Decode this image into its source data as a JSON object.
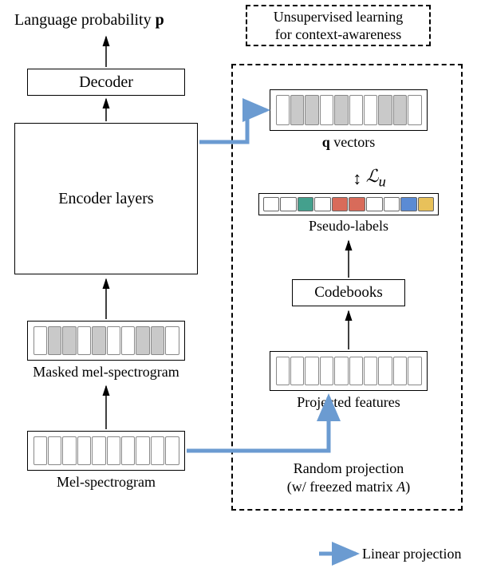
{
  "title_box": "Unsupervised learning\nfor context-awareness",
  "top_label_prefix": "Language probability ",
  "top_label_var": "p",
  "decoder": "Decoder",
  "encoder": "Encoder layers",
  "masked_mel": "Masked mel-spectrogram",
  "mel": "Mel-spectrogram",
  "q_vectors_prefix": "q",
  "q_vectors_suffix": " vectors",
  "pseudo_labels": "Pseudo-labels",
  "codebooks": "Codebooks",
  "projected_features": "Projected features",
  "random_projection": "Random projection",
  "random_projection_sub": "(w/ freezed matrix A)",
  "loss_label": "ℒ",
  "loss_sub": "u",
  "legend": "Linear projection",
  "colors_masked": [
    "#fff",
    "#c9c9c9",
    "#c9c9c9",
    "#fff",
    "#c9c9c9",
    "#fff",
    "#fff",
    "#c9c9c9",
    "#c9c9c9",
    "#fff"
  ],
  "colors_q": [
    "#fff",
    "#c9c9c9",
    "#c9c9c9",
    "#fff",
    "#c9c9c9",
    "#fff",
    "#fff",
    "#c9c9c9",
    "#c9c9c9",
    "#fff"
  ],
  "colors_plain": [
    "#fff",
    "#fff",
    "#fff",
    "#fff",
    "#fff",
    "#fff",
    "#fff",
    "#fff",
    "#fff",
    "#fff"
  ],
  "colors_pseudo": [
    "#fff",
    "#fff",
    "#44a08d",
    "#fff",
    "#d86b5a",
    "#d86b5a",
    "#fff",
    "#fff",
    "#5b8bd4",
    "#e8c15a"
  ]
}
